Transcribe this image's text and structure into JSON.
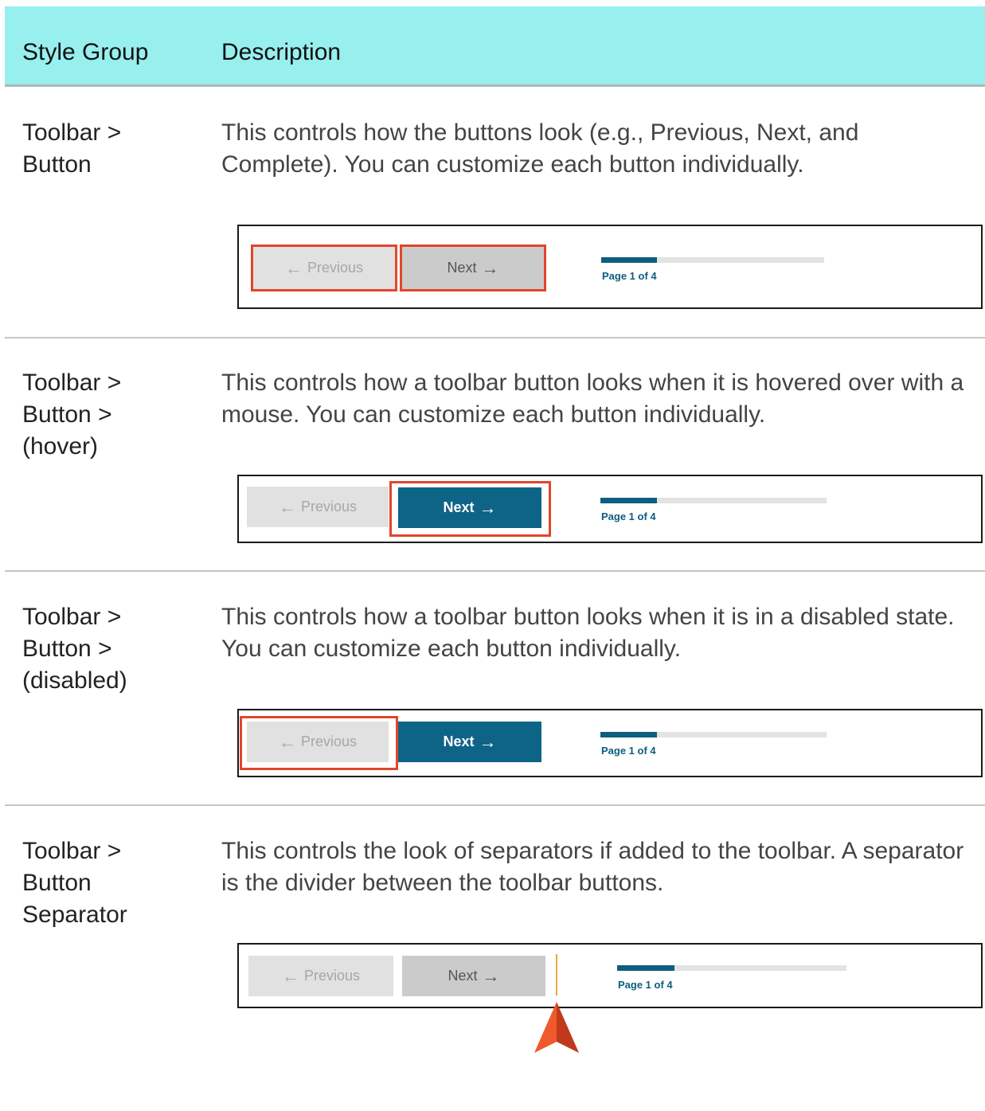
{
  "table": {
    "headers": {
      "style_group": "Style Group",
      "description": "Description"
    },
    "rows": [
      {
        "group_lines": [
          "Toolbar >",
          "Button"
        ],
        "description": "This controls how the buttons look (e.g., Previous, Next, and Complete). You can customize each button individually."
      },
      {
        "group_lines": [
          "Toolbar >",
          "Button >",
          "(hover)"
        ],
        "description": "This controls how a toolbar button looks when it is hovered over with a mouse. You can customize each button individually."
      },
      {
        "group_lines": [
          "Toolbar >",
          "Button >",
          "(disabled)"
        ],
        "description": "This controls how a toolbar button looks when it is in a disabled state. You can customize each button individually."
      },
      {
        "group_lines": [
          "Toolbar >",
          "Button",
          "Separator"
        ],
        "description": "This controls the look of separators if added to the toolbar. A separator is the divider between the toolbar buttons."
      }
    ]
  },
  "toolbar": {
    "previous_label": "Previous",
    "next_label": "Next",
    "page_label": "Page 1 of 4",
    "progress_fraction": 0.25,
    "back_arrow": "←",
    "forward_arrow": "→"
  },
  "colors": {
    "header_bg": "#97efee",
    "button_blue": "#0e6487",
    "highlight_red": "#e0462a",
    "separator_gold": "#e8a640",
    "pointer_orange": "#e9502a"
  }
}
